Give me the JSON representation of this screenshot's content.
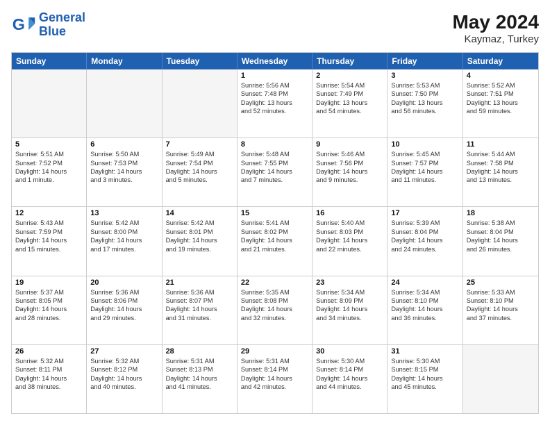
{
  "logo": {
    "line1": "General",
    "line2": "Blue"
  },
  "title": "May 2024",
  "subtitle": "Kaymaz, Turkey",
  "weekdays": [
    "Sunday",
    "Monday",
    "Tuesday",
    "Wednesday",
    "Thursday",
    "Friday",
    "Saturday"
  ],
  "rows": [
    [
      {
        "day": "",
        "info": "",
        "empty": true
      },
      {
        "day": "",
        "info": "",
        "empty": true
      },
      {
        "day": "",
        "info": "",
        "empty": true
      },
      {
        "day": "1",
        "info": "Sunrise: 5:56 AM\nSunset: 7:48 PM\nDaylight: 13 hours\nand 52 minutes."
      },
      {
        "day": "2",
        "info": "Sunrise: 5:54 AM\nSunset: 7:49 PM\nDaylight: 13 hours\nand 54 minutes."
      },
      {
        "day": "3",
        "info": "Sunrise: 5:53 AM\nSunset: 7:50 PM\nDaylight: 13 hours\nand 56 minutes."
      },
      {
        "day": "4",
        "info": "Sunrise: 5:52 AM\nSunset: 7:51 PM\nDaylight: 13 hours\nand 59 minutes."
      }
    ],
    [
      {
        "day": "5",
        "info": "Sunrise: 5:51 AM\nSunset: 7:52 PM\nDaylight: 14 hours\nand 1 minute."
      },
      {
        "day": "6",
        "info": "Sunrise: 5:50 AM\nSunset: 7:53 PM\nDaylight: 14 hours\nand 3 minutes."
      },
      {
        "day": "7",
        "info": "Sunrise: 5:49 AM\nSunset: 7:54 PM\nDaylight: 14 hours\nand 5 minutes."
      },
      {
        "day": "8",
        "info": "Sunrise: 5:48 AM\nSunset: 7:55 PM\nDaylight: 14 hours\nand 7 minutes."
      },
      {
        "day": "9",
        "info": "Sunrise: 5:46 AM\nSunset: 7:56 PM\nDaylight: 14 hours\nand 9 minutes."
      },
      {
        "day": "10",
        "info": "Sunrise: 5:45 AM\nSunset: 7:57 PM\nDaylight: 14 hours\nand 11 minutes."
      },
      {
        "day": "11",
        "info": "Sunrise: 5:44 AM\nSunset: 7:58 PM\nDaylight: 14 hours\nand 13 minutes."
      }
    ],
    [
      {
        "day": "12",
        "info": "Sunrise: 5:43 AM\nSunset: 7:59 PM\nDaylight: 14 hours\nand 15 minutes."
      },
      {
        "day": "13",
        "info": "Sunrise: 5:42 AM\nSunset: 8:00 PM\nDaylight: 14 hours\nand 17 minutes."
      },
      {
        "day": "14",
        "info": "Sunrise: 5:42 AM\nSunset: 8:01 PM\nDaylight: 14 hours\nand 19 minutes."
      },
      {
        "day": "15",
        "info": "Sunrise: 5:41 AM\nSunset: 8:02 PM\nDaylight: 14 hours\nand 21 minutes."
      },
      {
        "day": "16",
        "info": "Sunrise: 5:40 AM\nSunset: 8:03 PM\nDaylight: 14 hours\nand 22 minutes."
      },
      {
        "day": "17",
        "info": "Sunrise: 5:39 AM\nSunset: 8:04 PM\nDaylight: 14 hours\nand 24 minutes."
      },
      {
        "day": "18",
        "info": "Sunrise: 5:38 AM\nSunset: 8:04 PM\nDaylight: 14 hours\nand 26 minutes."
      }
    ],
    [
      {
        "day": "19",
        "info": "Sunrise: 5:37 AM\nSunset: 8:05 PM\nDaylight: 14 hours\nand 28 minutes."
      },
      {
        "day": "20",
        "info": "Sunrise: 5:36 AM\nSunset: 8:06 PM\nDaylight: 14 hours\nand 29 minutes."
      },
      {
        "day": "21",
        "info": "Sunrise: 5:36 AM\nSunset: 8:07 PM\nDaylight: 14 hours\nand 31 minutes."
      },
      {
        "day": "22",
        "info": "Sunrise: 5:35 AM\nSunset: 8:08 PM\nDaylight: 14 hours\nand 32 minutes."
      },
      {
        "day": "23",
        "info": "Sunrise: 5:34 AM\nSunset: 8:09 PM\nDaylight: 14 hours\nand 34 minutes."
      },
      {
        "day": "24",
        "info": "Sunrise: 5:34 AM\nSunset: 8:10 PM\nDaylight: 14 hours\nand 36 minutes."
      },
      {
        "day": "25",
        "info": "Sunrise: 5:33 AM\nSunset: 8:10 PM\nDaylight: 14 hours\nand 37 minutes."
      }
    ],
    [
      {
        "day": "26",
        "info": "Sunrise: 5:32 AM\nSunset: 8:11 PM\nDaylight: 14 hours\nand 38 minutes."
      },
      {
        "day": "27",
        "info": "Sunrise: 5:32 AM\nSunset: 8:12 PM\nDaylight: 14 hours\nand 40 minutes."
      },
      {
        "day": "28",
        "info": "Sunrise: 5:31 AM\nSunset: 8:13 PM\nDaylight: 14 hours\nand 41 minutes."
      },
      {
        "day": "29",
        "info": "Sunrise: 5:31 AM\nSunset: 8:14 PM\nDaylight: 14 hours\nand 42 minutes."
      },
      {
        "day": "30",
        "info": "Sunrise: 5:30 AM\nSunset: 8:14 PM\nDaylight: 14 hours\nand 44 minutes."
      },
      {
        "day": "31",
        "info": "Sunrise: 5:30 AM\nSunset: 8:15 PM\nDaylight: 14 hours\nand 45 minutes."
      },
      {
        "day": "",
        "info": "",
        "empty": true
      }
    ]
  ]
}
